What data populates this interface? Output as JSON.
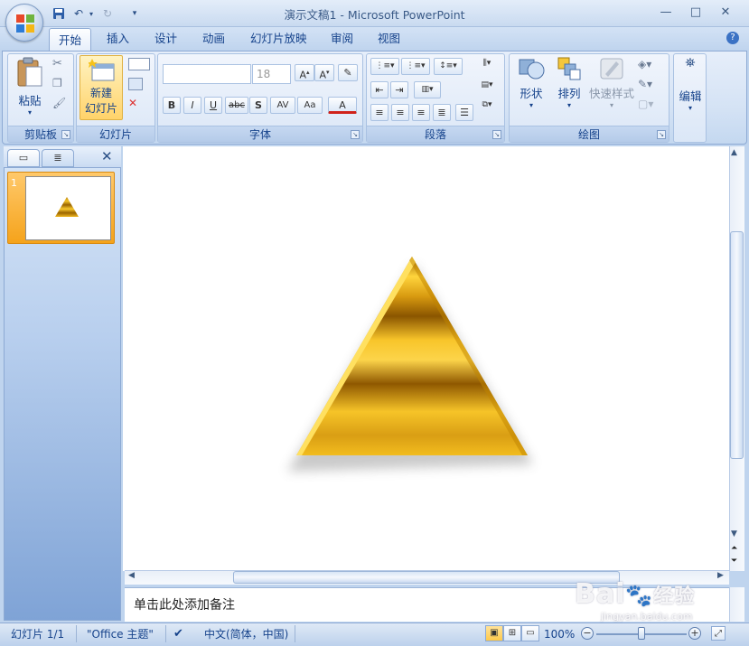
{
  "window": {
    "title": "演示文稿1 - Microsoft PowerPoint",
    "minimize": "—",
    "maximize": "□",
    "close": "✕"
  },
  "tabs": [
    "开始",
    "插入",
    "设计",
    "动画",
    "幻灯片放映",
    "审阅",
    "视图"
  ],
  "ribbon": {
    "clipboard": {
      "label": "剪贴板",
      "paste": "粘贴"
    },
    "slides": {
      "label": "幻灯片",
      "new_slide_line1": "新建",
      "new_slide_line2": "幻灯片"
    },
    "font": {
      "label": "字体",
      "size": "18",
      "bold": "B",
      "italic": "I",
      "underline": "U",
      "strike": "abc",
      "shadow": "S",
      "spacing": "AV",
      "case": "Aa",
      "color": "A"
    },
    "paragraph": {
      "label": "段落"
    },
    "drawing": {
      "label": "绘图",
      "shapes": "形状",
      "arrange": "排列",
      "quick_styles": "快速样式"
    },
    "editing": {
      "label": "编辑"
    }
  },
  "pane": {
    "slide_number": "1"
  },
  "notes": {
    "placeholder": "单击此处添加备注"
  },
  "status": {
    "slide": "幻灯片 1/1",
    "theme": "\"Office 主题\"",
    "language": "中文(简体，中国)",
    "zoom": "100%"
  },
  "watermark": {
    "brand": "Bai",
    "brand2": "经验",
    "url": "jingyan.baidu.com"
  },
  "colors": {
    "accent": "#15428b",
    "gold_light": "#ffd34a",
    "gold_dark": "#8a5a00"
  }
}
